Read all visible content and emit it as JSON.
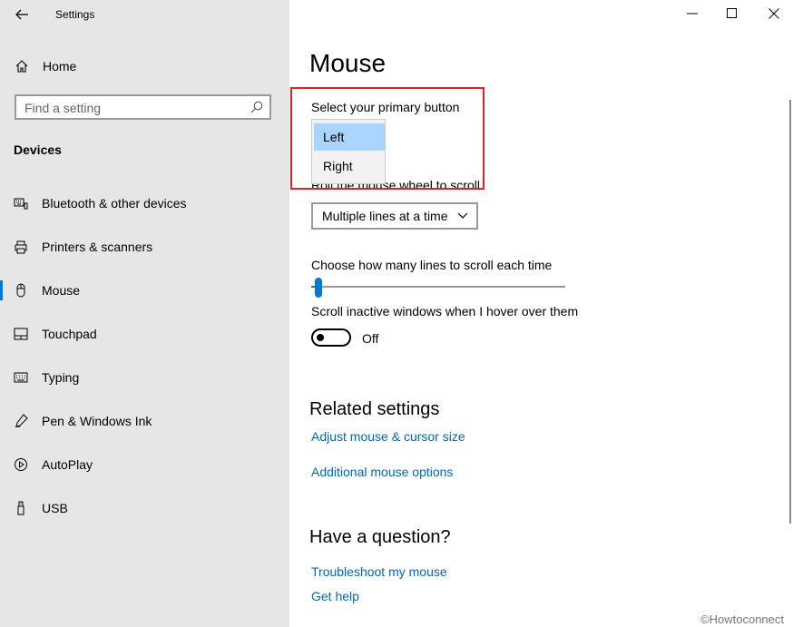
{
  "app": {
    "title": "Settings"
  },
  "sidebar": {
    "home_label": "Home",
    "search_placeholder": "Find a setting",
    "section": "Devices",
    "items": [
      {
        "label": "Bluetooth & other devices",
        "icon": "bluetooth-keyboard-icon"
      },
      {
        "label": "Printers & scanners",
        "icon": "printer-icon"
      },
      {
        "label": "Mouse",
        "icon": "mouse-icon",
        "active": true
      },
      {
        "label": "Touchpad",
        "icon": "touchpad-icon"
      },
      {
        "label": "Typing",
        "icon": "keyboard-icon"
      },
      {
        "label": "Pen & Windows Ink",
        "icon": "pen-icon"
      },
      {
        "label": "AutoPlay",
        "icon": "autoplay-icon"
      },
      {
        "label": "USB",
        "icon": "usb-icon"
      }
    ]
  },
  "main": {
    "title": "Mouse",
    "primary_button_label": "Select your primary button",
    "primary_button_options": [
      "Left",
      "Right"
    ],
    "primary_button_selected": "Left",
    "scroll_label_partial": "Roll the mouse wheel to scroll",
    "scroll_select_value": "Multiple lines at a time",
    "lines_label": "Choose how many lines to scroll each time",
    "lines_value_fraction": 0.03,
    "inactive_label": "Scroll inactive windows when I hover over them",
    "inactive_state": "Off",
    "related_title": "Related settings",
    "related_links": [
      "Adjust mouse & cursor size",
      "Additional mouse options"
    ],
    "question_title": "Have a question?",
    "question_links": [
      "Troubleshoot my mouse",
      "Get help"
    ]
  },
  "watermark": "©Howtoconnect",
  "colors": {
    "accent": "#0078d7",
    "link": "#0067b8",
    "highlight_box": "#e0202a",
    "sidebar_bg": "#e6e6e6"
  }
}
